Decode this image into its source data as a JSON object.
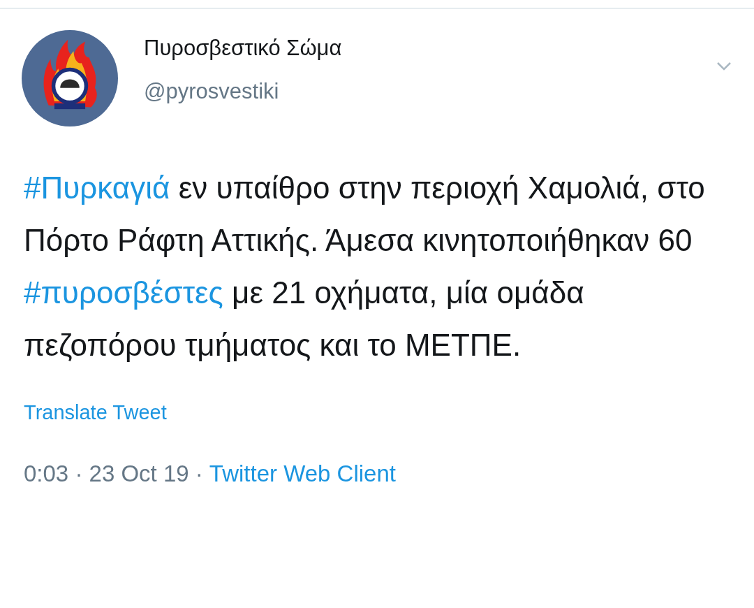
{
  "tweet": {
    "author": {
      "name": "Πυροσβεστικό Σώμα",
      "handle": "@pyrosvestiki"
    },
    "body": [
      {
        "kind": "hashtag",
        "text": "#Πυρκαγιά"
      },
      {
        "kind": "text",
        "text": " εν υπαίθρο στην περιοχή Χαμολιά, στο Πόρτο Ράφτη Αττικής. Άμεσα κινητοποιήθηκαν 60 "
      },
      {
        "kind": "hashtag",
        "text": "#πυροσβέστες"
      },
      {
        "kind": "text",
        "text": " με 21 οχήματα, μία ομάδα πεζοπόρου τμήματος και το ΜΕΤΠΕ."
      }
    ],
    "translate": "Translate Tweet",
    "meta": {
      "time": "0:03 · 23 Oct 19 ·",
      "source": "Twitter Web Client"
    }
  }
}
